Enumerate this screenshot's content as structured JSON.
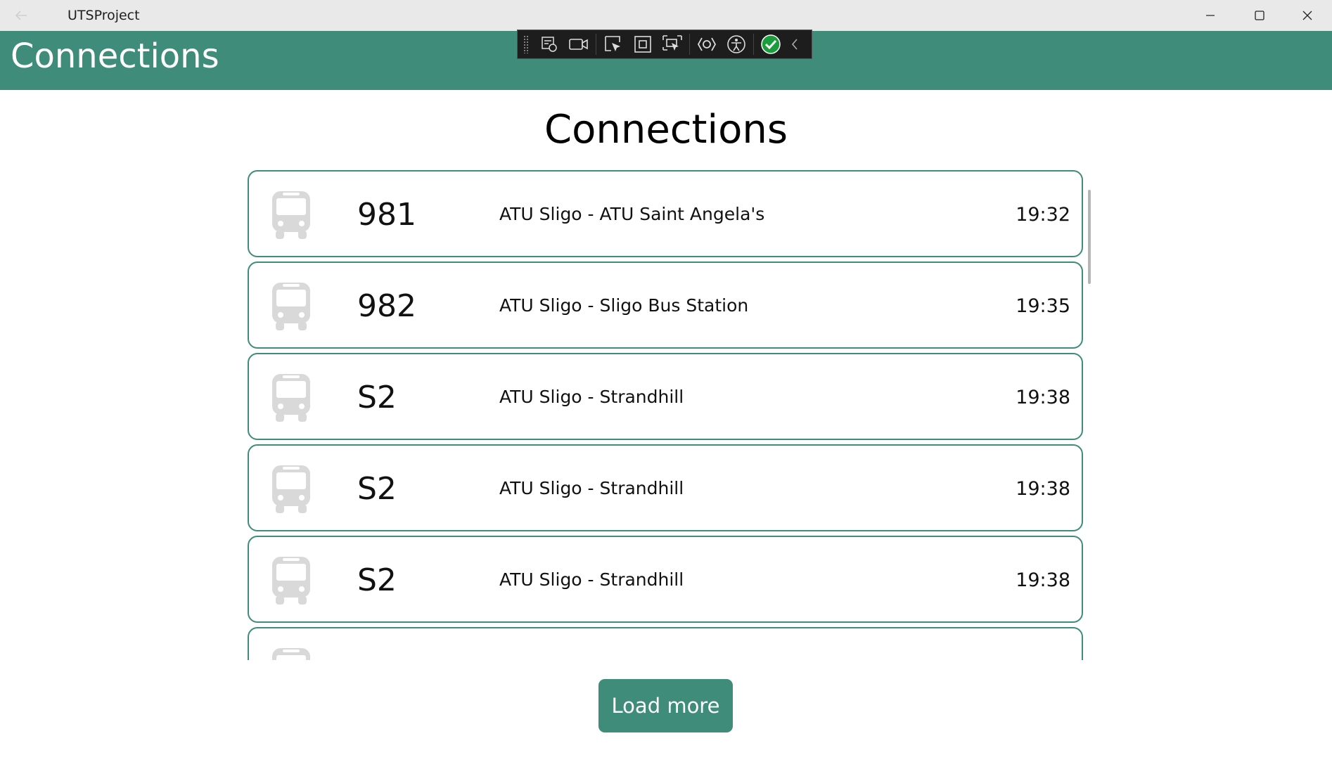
{
  "window": {
    "title": "UTSProject",
    "back_icon": "arrow-left-icon",
    "minimize_icon": "minimize-icon",
    "maximize_icon": "maximize-icon",
    "close_icon": "close-icon"
  },
  "header": {
    "title": "Connections",
    "color": "#3e8c79"
  },
  "devtools": {
    "icons": [
      "live-visual-tree-icon",
      "record-icon",
      "select-element-icon",
      "display-layout-adorners-icon",
      "track-focus-icon",
      "hot-reload-icon",
      "accessibility-icon",
      "check-icon",
      "collapse-chevron-icon"
    ]
  },
  "main": {
    "heading": "Connections",
    "connections": [
      {
        "icon": "bus-icon",
        "number": "981",
        "route": "ATU Sligo - ATU Saint Angela's",
        "time": "19:32"
      },
      {
        "icon": "bus-icon",
        "number": "982",
        "route": "ATU Sligo - Sligo Bus Station",
        "time": "19:35"
      },
      {
        "icon": "bus-icon",
        "number": "S2",
        "route": "ATU Sligo - Strandhill",
        "time": "19:38"
      },
      {
        "icon": "bus-icon",
        "number": "S2",
        "route": "ATU Sligo - Strandhill",
        "time": "19:38"
      },
      {
        "icon": "bus-icon",
        "number": "S2",
        "route": "ATU Sligo - Strandhill",
        "time": "19:38"
      },
      {
        "icon": "bus-icon",
        "number": "",
        "route": "",
        "time": ""
      }
    ],
    "load_more_label": "Load more"
  }
}
